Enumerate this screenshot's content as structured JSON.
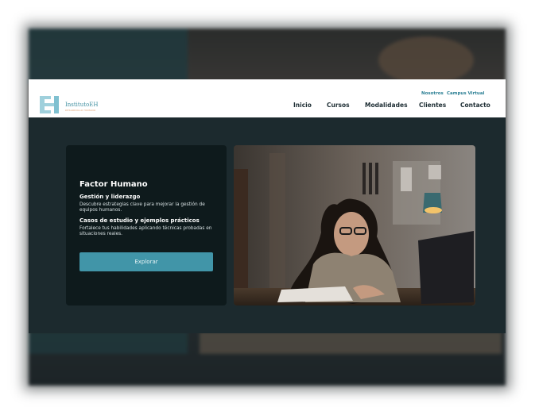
{
  "brand": {
    "name": "InstitutoEH",
    "tagline": "DESARROLLO HUMANO"
  },
  "header": {
    "utility_links": [
      "Nosotros",
      "Campus Virtual"
    ],
    "nav": [
      "Inicio",
      "Cursos",
      "Modalidades",
      "Clientes",
      "Contacto"
    ]
  },
  "hero": {
    "title": "Factor Humano",
    "section1_title": "Gestión y liderazgo",
    "section1_text": "Descubre estrategias clave para mejorar la gestión de equipos humanos.",
    "section2_title": "Casos de estudio y ejemplos prácticos",
    "section2_text": "Fortalece tus habilidades aplicando técnicas probadas en situaciones reales.",
    "button_label": "Explorar"
  },
  "colors": {
    "accent": "#4195a8",
    "card_bg": "#0e1a1c",
    "page_bg": "#1c2a2e",
    "header_bg": "#ffffff"
  },
  "icons": {
    "logo": "eh-logo-icon"
  }
}
